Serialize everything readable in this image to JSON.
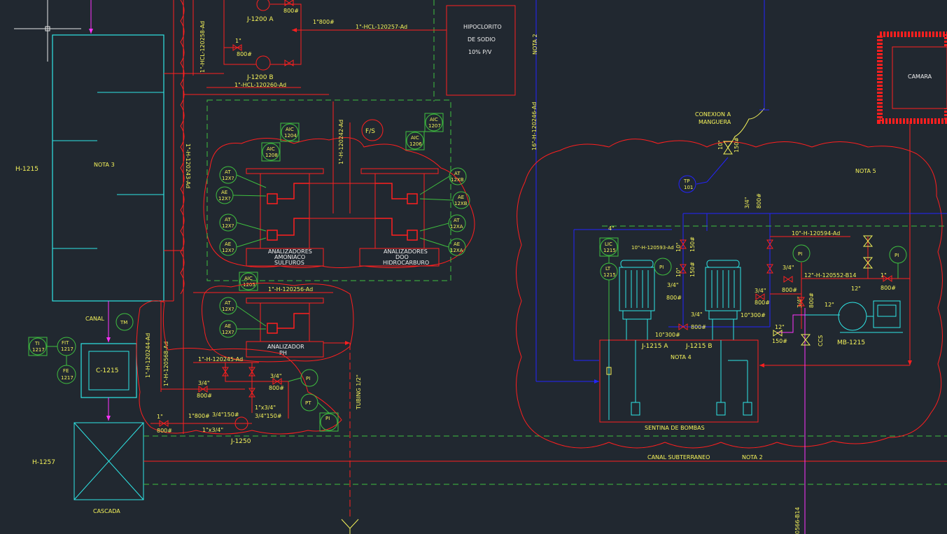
{
  "labels": {
    "h1215": "H-1215",
    "nota3": "NOTA 3",
    "canal": "CANAL",
    "c1215": "C-1215",
    "h1257": "H-1257",
    "cascada": "CASCADA",
    "hipo1": "HIPOCLORITO",
    "hipo2": "DE SODIO",
    "hipo3": "10% P/V",
    "j1200a": "J-1200 A",
    "j1200b": "J-1200 B",
    "line_hcl_257": "1\"-HCL-120257-Ad",
    "line_hcl_260": "1\"-HCL-120260-Ad",
    "line_hcl_258": "1\"-HCL-120258-Ad",
    "line_h_242": "1\"-H-120242-Ad",
    "line_h_243": "1\"-H-120243-Ad",
    "line_h_256": "1\"-H-120256-Ad",
    "line_h_245": "1\"-H-120245-Ad",
    "line_h_244": "1\"-H-120244-Ad",
    "line_h_568": "1\"-H-120568-Ad",
    "line_h_246": "16\"-H-120246-Ad",
    "line_h_594": "10\"-H-120594-Ad",
    "line_h_593": "10\"-H-120593-Ad",
    "line_h_552": "12\"-H-120552-B14",
    "line_566": "0566-B14",
    "fs": "F/S",
    "an_amon1": "ANALIZADORES",
    "an_amon2": "AMONIACO",
    "an_amon3": "SULFUROS",
    "an_hidro1": "ANALIZADORES",
    "an_hidro2": "DOO",
    "an_hidro3": "HIDROCARBURO",
    "an_ph1": "ANALIZADOR",
    "an_ph2": "PH",
    "tubing": "TUBING 1/2\"",
    "j1250": "J-1250",
    "nota2_v": "NOTA 2",
    "nota2_h": "NOTA 2",
    "nota4": "NOTA 4",
    "nota5": "NOTA 5",
    "conexion1": "CONEXION A",
    "conexion2": "MANGUERA",
    "camara": "CAMARA",
    "sentina": "SENTINA DE BOMBAS",
    "canal_sub": "CANAL SUBTERRANEO",
    "j1215a": "J-1215 A",
    "j1215b": "J-1215 B",
    "mb1215": "MB-1215",
    "ccs": "CCS",
    "tp": "TP",
    "tp_n": "101",
    "size_800": "800#",
    "size_1in": "1\"",
    "size_34": "3/4\"",
    "size_150": "150#",
    "size_10": "10\"",
    "size_12": "12\"",
    "size_4": "4\"",
    "size_1_800": "1\"800#",
    "size_10_300": "10\"300#",
    "size_34_150": "3/4\"150#",
    "size_1x34": "1\"x3/4\""
  },
  "instruments": [
    {
      "tag": "AIC",
      "num": "1204"
    },
    {
      "tag": "AIC",
      "num": "1208"
    },
    {
      "tag": "AIC",
      "num": "1206"
    },
    {
      "tag": "AIC",
      "num": "1207"
    },
    {
      "tag": "AIC",
      "num": "1205"
    },
    {
      "tag": "AT",
      "num": "12X?"
    },
    {
      "tag": "AE",
      "num": "12X?"
    },
    {
      "tag": "AT",
      "num": "12X?"
    },
    {
      "tag": "AE",
      "num": "12X?"
    },
    {
      "tag": "AT",
      "num": "12XB"
    },
    {
      "tag": "AE",
      "num": "12XB"
    },
    {
      "tag": "AT",
      "num": "12XA"
    },
    {
      "tag": "AE",
      "num": "12XA"
    },
    {
      "tag": "AT",
      "num": "12X?"
    },
    {
      "tag": "AE",
      "num": "12X?"
    },
    {
      "tag": "TI",
      "num": "1217"
    },
    {
      "tag": "FIT",
      "num": "1217"
    },
    {
      "tag": "FE",
      "num": "1217"
    },
    {
      "tag": "TM",
      "num": ""
    },
    {
      "tag": "PI",
      "num": ""
    },
    {
      "tag": "PT",
      "num": ""
    },
    {
      "tag": "PI",
      "num": ""
    },
    {
      "tag": "LIC",
      "num": "1215"
    },
    {
      "tag": "LT",
      "num": "1215"
    },
    {
      "tag": "PI",
      "num": ""
    },
    {
      "tag": "PI",
      "num": ""
    },
    {
      "tag": "PI",
      "num": ""
    }
  ],
  "colors": {
    "background": "#212830",
    "red": "#ff1f1f",
    "cyan": "#2fe6e6",
    "green": "#3fbf3f",
    "yellow": "#f5f35a",
    "blue": "#2424ff",
    "magenta": "#ff33ff",
    "white": "#f0f0f0"
  }
}
